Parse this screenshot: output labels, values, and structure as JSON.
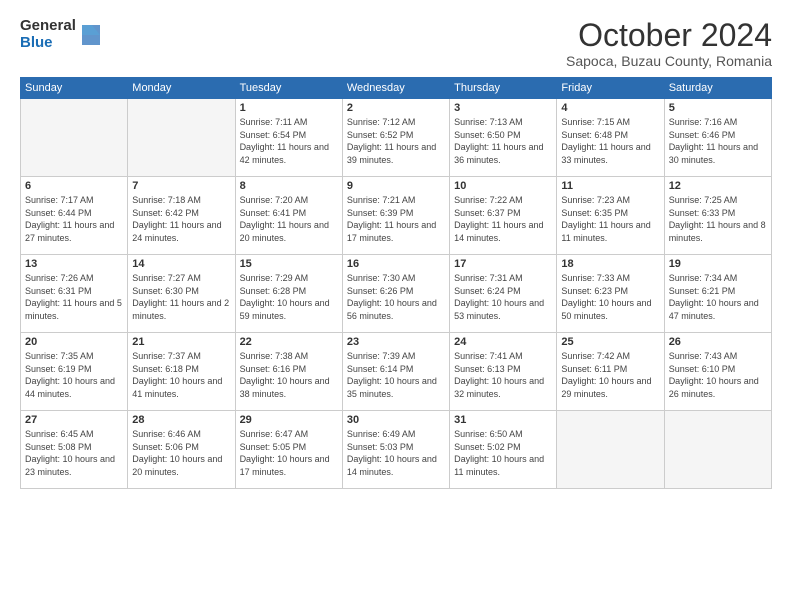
{
  "logo": {
    "general": "General",
    "blue": "Blue"
  },
  "header": {
    "month": "October 2024",
    "location": "Sapoca, Buzau County, Romania"
  },
  "weekdays": [
    "Sunday",
    "Monday",
    "Tuesday",
    "Wednesday",
    "Thursday",
    "Friday",
    "Saturday"
  ],
  "weeks": [
    [
      {
        "day": "",
        "empty": true
      },
      {
        "day": "",
        "empty": true
      },
      {
        "day": "1",
        "sunrise": "7:11 AM",
        "sunset": "6:54 PM",
        "daylight": "11 hours and 42 minutes."
      },
      {
        "day": "2",
        "sunrise": "7:12 AM",
        "sunset": "6:52 PM",
        "daylight": "11 hours and 39 minutes."
      },
      {
        "day": "3",
        "sunrise": "7:13 AM",
        "sunset": "6:50 PM",
        "daylight": "11 hours and 36 minutes."
      },
      {
        "day": "4",
        "sunrise": "7:15 AM",
        "sunset": "6:48 PM",
        "daylight": "11 hours and 33 minutes."
      },
      {
        "day": "5",
        "sunrise": "7:16 AM",
        "sunset": "6:46 PM",
        "daylight": "11 hours and 30 minutes."
      }
    ],
    [
      {
        "day": "6",
        "sunrise": "7:17 AM",
        "sunset": "6:44 PM",
        "daylight": "11 hours and 27 minutes."
      },
      {
        "day": "7",
        "sunrise": "7:18 AM",
        "sunset": "6:42 PM",
        "daylight": "11 hours and 24 minutes."
      },
      {
        "day": "8",
        "sunrise": "7:20 AM",
        "sunset": "6:41 PM",
        "daylight": "11 hours and 20 minutes."
      },
      {
        "day": "9",
        "sunrise": "7:21 AM",
        "sunset": "6:39 PM",
        "daylight": "11 hours and 17 minutes."
      },
      {
        "day": "10",
        "sunrise": "7:22 AM",
        "sunset": "6:37 PM",
        "daylight": "11 hours and 14 minutes."
      },
      {
        "day": "11",
        "sunrise": "7:23 AM",
        "sunset": "6:35 PM",
        "daylight": "11 hours and 11 minutes."
      },
      {
        "day": "12",
        "sunrise": "7:25 AM",
        "sunset": "6:33 PM",
        "daylight": "11 hours and 8 minutes."
      }
    ],
    [
      {
        "day": "13",
        "sunrise": "7:26 AM",
        "sunset": "6:31 PM",
        "daylight": "11 hours and 5 minutes."
      },
      {
        "day": "14",
        "sunrise": "7:27 AM",
        "sunset": "6:30 PM",
        "daylight": "11 hours and 2 minutes."
      },
      {
        "day": "15",
        "sunrise": "7:29 AM",
        "sunset": "6:28 PM",
        "daylight": "10 hours and 59 minutes."
      },
      {
        "day": "16",
        "sunrise": "7:30 AM",
        "sunset": "6:26 PM",
        "daylight": "10 hours and 56 minutes."
      },
      {
        "day": "17",
        "sunrise": "7:31 AM",
        "sunset": "6:24 PM",
        "daylight": "10 hours and 53 minutes."
      },
      {
        "day": "18",
        "sunrise": "7:33 AM",
        "sunset": "6:23 PM",
        "daylight": "10 hours and 50 minutes."
      },
      {
        "day": "19",
        "sunrise": "7:34 AM",
        "sunset": "6:21 PM",
        "daylight": "10 hours and 47 minutes."
      }
    ],
    [
      {
        "day": "20",
        "sunrise": "7:35 AM",
        "sunset": "6:19 PM",
        "daylight": "10 hours and 44 minutes."
      },
      {
        "day": "21",
        "sunrise": "7:37 AM",
        "sunset": "6:18 PM",
        "daylight": "10 hours and 41 minutes."
      },
      {
        "day": "22",
        "sunrise": "7:38 AM",
        "sunset": "6:16 PM",
        "daylight": "10 hours and 38 minutes."
      },
      {
        "day": "23",
        "sunrise": "7:39 AM",
        "sunset": "6:14 PM",
        "daylight": "10 hours and 35 minutes."
      },
      {
        "day": "24",
        "sunrise": "7:41 AM",
        "sunset": "6:13 PM",
        "daylight": "10 hours and 32 minutes."
      },
      {
        "day": "25",
        "sunrise": "7:42 AM",
        "sunset": "6:11 PM",
        "daylight": "10 hours and 29 minutes."
      },
      {
        "day": "26",
        "sunrise": "7:43 AM",
        "sunset": "6:10 PM",
        "daylight": "10 hours and 26 minutes."
      }
    ],
    [
      {
        "day": "27",
        "sunrise": "6:45 AM",
        "sunset": "5:08 PM",
        "daylight": "10 hours and 23 minutes."
      },
      {
        "day": "28",
        "sunrise": "6:46 AM",
        "sunset": "5:06 PM",
        "daylight": "10 hours and 20 minutes."
      },
      {
        "day": "29",
        "sunrise": "6:47 AM",
        "sunset": "5:05 PM",
        "daylight": "10 hours and 17 minutes."
      },
      {
        "day": "30",
        "sunrise": "6:49 AM",
        "sunset": "5:03 PM",
        "daylight": "10 hours and 14 minutes."
      },
      {
        "day": "31",
        "sunrise": "6:50 AM",
        "sunset": "5:02 PM",
        "daylight": "10 hours and 11 minutes."
      },
      {
        "day": "",
        "empty": true
      },
      {
        "day": "",
        "empty": true
      }
    ]
  ],
  "labels": {
    "sunrise": "Sunrise:",
    "sunset": "Sunset:",
    "daylight": "Daylight:"
  }
}
